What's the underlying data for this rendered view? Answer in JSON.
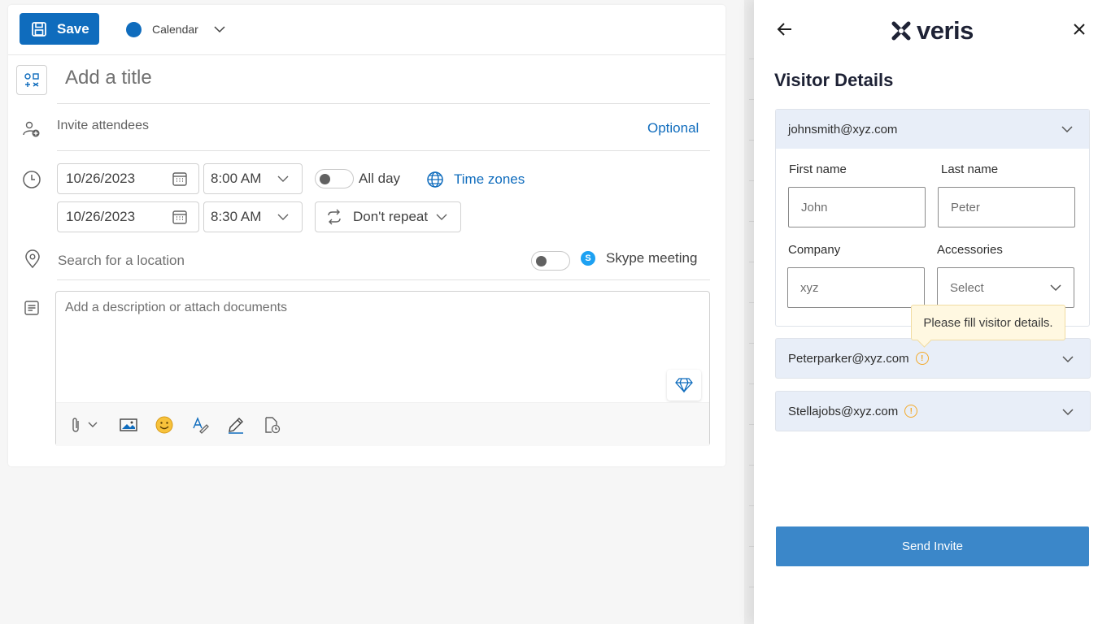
{
  "compose": {
    "save_label": "Save",
    "calendar_label": "Calendar",
    "title_placeholder": "Add a title",
    "attendees_placeholder": "Invite attendees",
    "optional_label": "Optional",
    "start_date": "10/26/2023",
    "start_time": "8:00 AM",
    "end_date": "10/26/2023",
    "end_time": "8:30 AM",
    "all_day_label": "All day",
    "time_zones_label": "Time zones",
    "repeat_label": "Don't repeat",
    "location_placeholder": "Search for a location",
    "skype_label": "Skype meeting",
    "description_placeholder": "Add a description or attach documents",
    "accent_color": "#0f6cbd"
  },
  "veris": {
    "logo_text": "veris",
    "title": "Visitor Details",
    "visitors": [
      {
        "email": "johnsmith@xyz.com",
        "expanded": true,
        "first_name_label": "First name",
        "first_name": "John",
        "last_name_label": "Last name",
        "last_name": "Peter",
        "company_label": "Company",
        "company": "xyz",
        "accessories_label": "Accessories",
        "accessories": "Select"
      },
      {
        "email": "Peterparker@xyz.com",
        "expanded": false,
        "warning": true
      },
      {
        "email": "Stellajobs@xyz.com",
        "expanded": false,
        "warning": true
      }
    ],
    "tooltip": "Please fill visitor details.",
    "send_label": "Send Invite",
    "button_color": "#3b87c9"
  }
}
